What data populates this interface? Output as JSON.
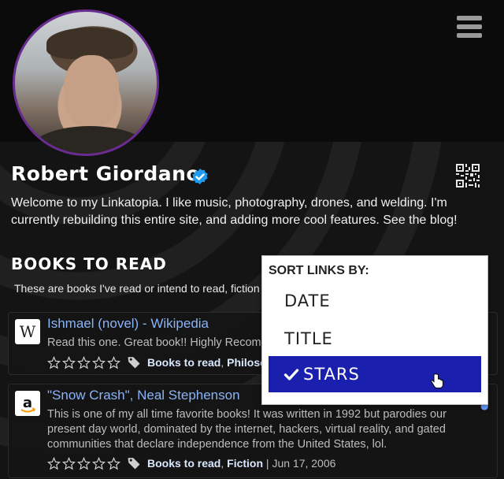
{
  "profile": {
    "name": "Robert Giordano",
    "bio": "Welcome to my Linkatopia. I like music, photography, drones, and welding. I'm currently rebuilding this entire site, and adding more cool features. See the blog!"
  },
  "section": {
    "title": "BOOKS TO READ",
    "description": "These are books I've read or intend to read, fiction"
  },
  "items": [
    {
      "favicon": "W",
      "title": "Ishmael (novel) - Wikipedia",
      "description": "Read this one. Great book!! Highly Recommended",
      "tags": [
        "Books to read",
        "Philosophy"
      ],
      "stars": 0,
      "date": ""
    },
    {
      "favicon": "a",
      "title": "\"Snow Crash\", Neal Stephenson",
      "description": "This is one of my all time favorite books! It was written in 1992 but parodies our present day world, dominated by the internet, hackers, virtual reality, and gated communities that declare independence from the United States, lol.",
      "tags": [
        "Books to read",
        "Fiction"
      ],
      "stars": 0,
      "date": "Jun 17, 2006"
    }
  ],
  "sort_menu": {
    "heading": "SORT LINKS BY:",
    "options": [
      "DATE",
      "TITLE",
      "STARS"
    ],
    "selected": "STARS"
  },
  "separators": {
    "comma": ",",
    "pipe": "|"
  },
  "colors": {
    "avatar_border": "#6a2c91",
    "link": "#8ab4f8",
    "selected_option": "#1a1fae",
    "verified": "#1d9bf0"
  },
  "icons": [
    "menu-icon",
    "qr-code-icon",
    "verified-badge-icon",
    "star-outline-icon",
    "tag-icon",
    "wikipedia-favicon",
    "amazon-favicon",
    "checkmark-icon",
    "hand-cursor-icon"
  ]
}
